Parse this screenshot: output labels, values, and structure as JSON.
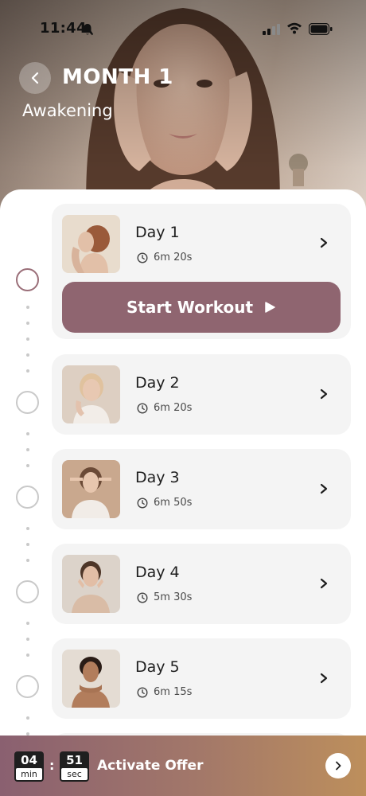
{
  "status_bar": {
    "time": "11:44"
  },
  "header": {
    "title": "MONTH 1",
    "subtitle": "Awakening"
  },
  "days": [
    {
      "title": "Day 1",
      "duration": "6m 20s",
      "active": true
    },
    {
      "title": "Day 2",
      "duration": "6m 20s",
      "active": false
    },
    {
      "title": "Day 3",
      "duration": "6m 50s",
      "active": false
    },
    {
      "title": "Day 4",
      "duration": "5m 30s",
      "active": false
    },
    {
      "title": "Day 5",
      "duration": "6m 15s",
      "active": false
    }
  ],
  "start_button": {
    "label": "Start Workout"
  },
  "offer": {
    "minutes": "04",
    "minutes_unit": "min",
    "seconds": "51",
    "seconds_unit": "sec",
    "label": "Activate Offer"
  },
  "colors": {
    "accent": "#8f6570",
    "card_bg": "#f4f4f4",
    "offer_gradient_start": "#8a6070",
    "offer_gradient_end": "#bd8f5c"
  }
}
